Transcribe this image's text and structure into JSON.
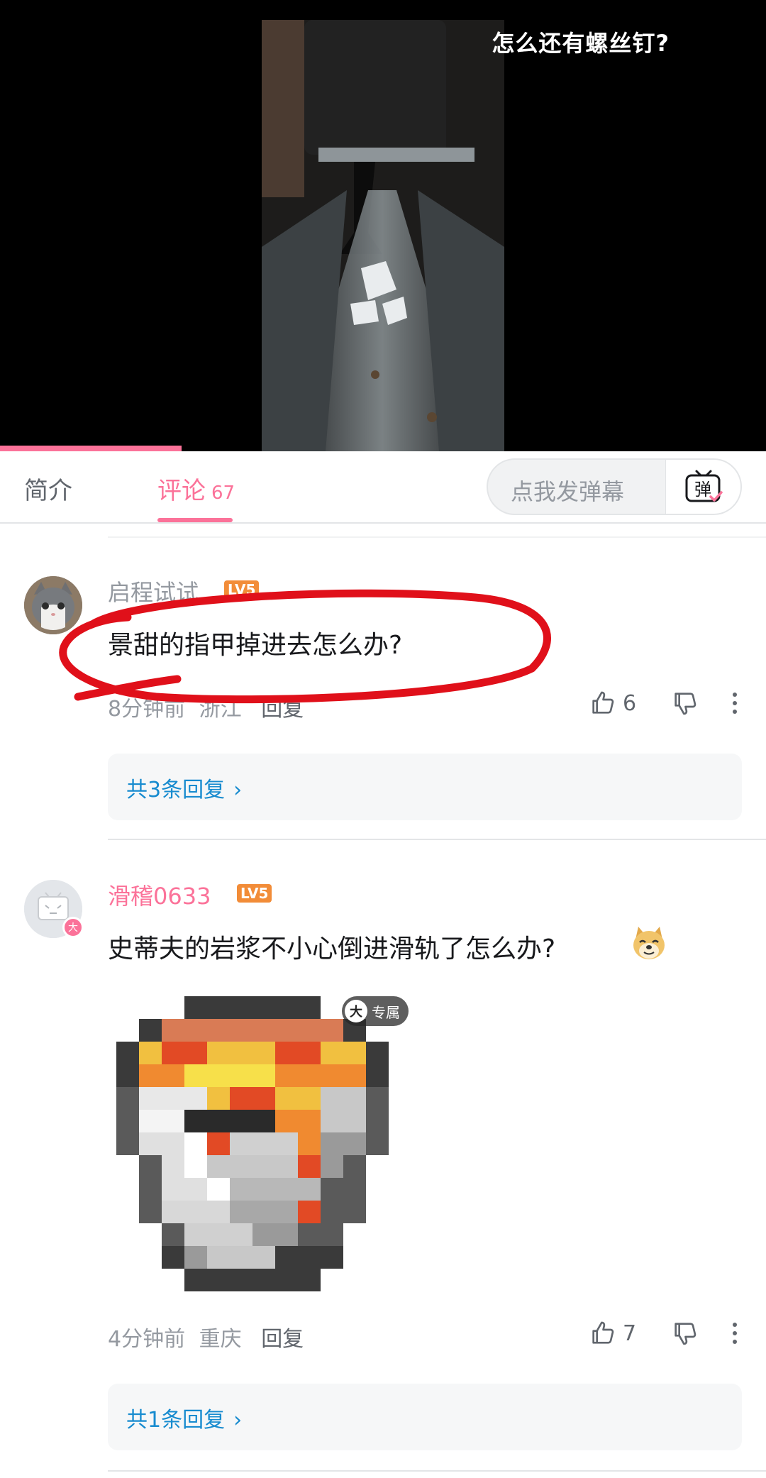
{
  "player": {
    "overlay_title": "怎么还有螺丝钉?",
    "progress": 0.237
  },
  "tabs": {
    "intro_label": "简介",
    "comments_label": "评论",
    "comments_count": "67",
    "danmaku_placeholder": "点我发弹幕",
    "danmaku_icon_glyph": "弹"
  },
  "comments": [
    {
      "username": "启程试试",
      "level": "LV5",
      "text": "景甜的指甲掉进去怎么办?",
      "time": "8分钟前",
      "location": "浙江",
      "reply_label": "回复",
      "likes": "6",
      "replies_label": "共3条回复",
      "chevron": "›"
    },
    {
      "username": "滑稽0633",
      "level": "LV5",
      "text": "史蒂夫的岩浆不小心倒进滑轨了怎么办?",
      "time": "4分钟前",
      "location": "重庆",
      "reply_label": "回复",
      "likes": "7",
      "replies_label": "共1条回复",
      "chevron": "›",
      "badge_glyph": "大",
      "sticker_badge_glyph": "大",
      "sticker_badge_label": "专属"
    }
  ],
  "colors": {
    "accent_pink": "#fb7299",
    "link_blue": "#178bcf",
    "annotation_red": "#e0101a"
  },
  "icons": [
    "thumb-up-icon",
    "thumb-down-icon",
    "more-vertical-icon",
    "tv-danmaku-icon",
    "doge-emoji-icon",
    "lava-bucket-sticker"
  ]
}
